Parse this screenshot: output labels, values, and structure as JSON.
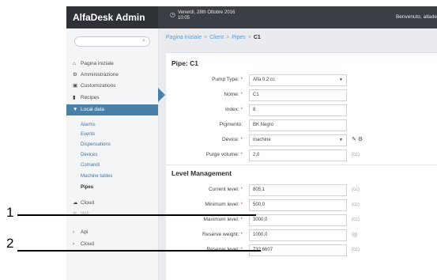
{
  "app": {
    "brand": "AlfaDesk Admin",
    "datetime_line1": "Venerdì, 28th Ottobre 2016",
    "datetime_line2": "10:05",
    "welcome": "Benvenuto, allade"
  },
  "search": {
    "placeholder": ""
  },
  "sidebar": {
    "items": [
      {
        "icon": "home-icon",
        "glyph": "⌂",
        "label": "Pagina iniziale"
      },
      {
        "icon": "gear-icon",
        "glyph": "⚙",
        "label": "Amministrazione"
      },
      {
        "icon": "image-icon",
        "glyph": "▣",
        "label": "Customizations"
      },
      {
        "icon": "book-icon",
        "glyph": "▮",
        "label": "Recipes"
      },
      {
        "icon": "chevron-down-icon",
        "glyph": "▼",
        "label": "Local data"
      }
    ],
    "sub_items": [
      "Alarms",
      "Events",
      "Dispensations",
      "Devices",
      "Comandi",
      "Machine tables",
      "Pipes"
    ],
    "bottom_items": [
      {
        "icon": "cloud-icon",
        "glyph": "☁",
        "label": "Cloud"
      },
      {
        "icon": "pipe-icon",
        "glyph": "≋",
        "label": "Wifi"
      },
      {
        "icon": "chevron-right-icon",
        "glyph": "›",
        "label": "Api"
      },
      {
        "icon": "chevron-right-icon",
        "glyph": "›",
        "label": "Cloud"
      }
    ]
  },
  "breadcrumb": {
    "items": [
      "Pagina iniziale",
      "Client",
      "Pipes"
    ],
    "current": "C1",
    "sep": ">"
  },
  "pipe_section": {
    "title": "Pipe: C1",
    "fields": {
      "pump_type": {
        "label": "Pump Type:",
        "value": "Alfa 0.2 cc",
        "caret": "▼"
      },
      "nome": {
        "label": "Nome:",
        "value": "C1"
      },
      "index": {
        "label": "Index:",
        "value": "8"
      },
      "pigmento": {
        "label": "Pigmento:",
        "value": "BK Negro"
      },
      "device": {
        "label": "Device:",
        "value": "machine",
        "caret": "▼"
      },
      "purge_volume": {
        "label": "Purge volume:",
        "value": "2,0",
        "unit": "(cc)"
      }
    },
    "req": "*"
  },
  "level_section": {
    "title": "Level Management",
    "fields": {
      "current": {
        "label": "Current level:",
        "value": "805,1",
        "unit": "(cc)"
      },
      "minimum": {
        "label": "Minimum level:",
        "value": "500,0",
        "unit": "(cc)"
      },
      "maximum": {
        "label": "Maximum level:",
        "value": "3000,0",
        "unit": "(cc)"
      },
      "reserve_weight": {
        "label": "Reserve weight:",
        "value": "1000,0",
        "unit": "(g)"
      },
      "reserve_level": {
        "label": "Reserve level:",
        "value": "732,6607",
        "unit": "(cc)"
      }
    }
  },
  "icons": {
    "pencil": "pencil-icon",
    "settings": "gear-icon"
  },
  "callouts": [
    "1",
    "2"
  ],
  "colors": {
    "topbar": "#3b3e44",
    "accent": "#4a7fa8",
    "link": "#3f73a6"
  }
}
